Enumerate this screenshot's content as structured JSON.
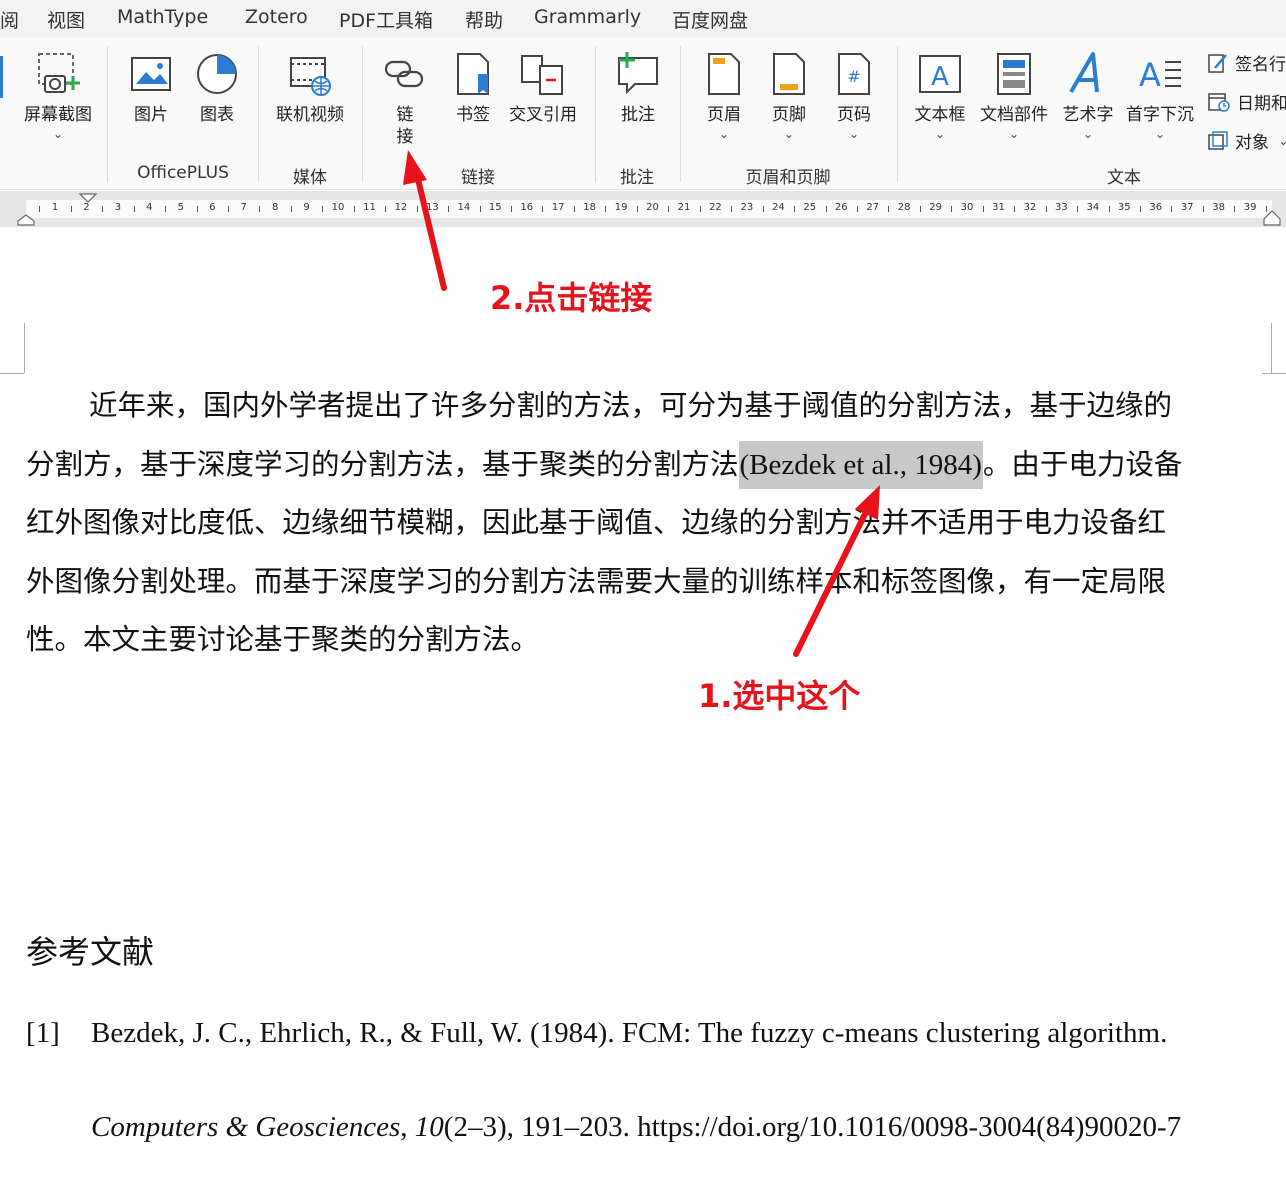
{
  "menubar": {
    "items": [
      "阅",
      "视图",
      "MathType",
      "Zotero",
      "PDF工具箱",
      "帮助",
      "Grammarly",
      "百度网盘"
    ]
  },
  "ribbon": {
    "buttons": {
      "screenshot": "屏幕截图",
      "picture": "图片",
      "chart": "图表",
      "online_video": "联机视频",
      "link": "链\n接",
      "link_line1": "链",
      "link_line2": "接",
      "bookmark": "书签",
      "cross_ref": "交叉引用",
      "comment": "批注",
      "header": "页眉",
      "footer": "页脚",
      "page_number": "页码",
      "text_box": "文本框",
      "quick_parts": "文档部件",
      "word_art": "艺术字",
      "drop_cap": "首字下沉",
      "signature": "签名行",
      "date_time": "日期和",
      "object": "对象"
    },
    "groups": {
      "officeplus": "OfficePLUS",
      "media": "媒体",
      "links": "链接",
      "comments": "批注",
      "header_footer": "页眉和页脚",
      "text": "文本"
    },
    "icon_names": [
      "screenshot-icon",
      "picture-icon",
      "chart-icon",
      "online-video-icon",
      "link-icon",
      "bookmark-icon",
      "cross-reference-icon",
      "comment-icon",
      "header-icon",
      "footer-icon",
      "page-number-icon",
      "text-box-icon",
      "quick-parts-icon",
      "word-art-icon",
      "drop-cap-icon",
      "signature-line-icon",
      "date-time-icon",
      "object-icon"
    ],
    "accent_color": "#2b7cd3"
  },
  "ruler": {
    "numbers": [
      "1",
      "2",
      "3",
      "4",
      "5",
      "6",
      "7",
      "8",
      "9",
      "10",
      "11",
      "12",
      "13",
      "14",
      "15",
      "16",
      "17",
      "18",
      "19",
      "20",
      "21",
      "22",
      "23",
      "24",
      "25",
      "26",
      "27",
      "28",
      "29",
      "30",
      "31",
      "32",
      "33",
      "34",
      "35",
      "36",
      "37",
      "38",
      "39"
    ]
  },
  "document": {
    "paragraph": {
      "line1": "近年来，国内外学者提出了许多分割的方法，可分为基于阈值的分割方法，基于边缘的",
      "line2_before": "分割方，基于深度学习的分割方法，基于聚类的分割方法",
      "citation": "(Bezdek et al., 1984)",
      "line2_after": "。由于电力设备",
      "line3": "红外图像对比度低、边缘细节模糊，因此基于阈值、边缘的分割方法并不适用于电力设备红",
      "line4": "外图像分割处理。而基于深度学习的分割方法需要大量的训练样本和标签图像，有一定局限",
      "line5": "性。本文主要讨论基于聚类的分割方法。"
    },
    "references_title": "参考文献",
    "reference1": {
      "number": "[1]",
      "line1": "Bezdek, J. C., Ehrlich, R., & Full, W. (1984). FCM: The fuzzy c-means clustering algorithm.",
      "journal": "Computers & Geosciences",
      "sep1": ", ",
      "volume": "10",
      "rest": "(2–3), 191–203. https://doi.org/10.1016/0098-3004(84)90020-7"
    }
  },
  "annotations": {
    "step2": "2.点击链接",
    "step1": "1.选中这个",
    "color": "#e8121b"
  }
}
